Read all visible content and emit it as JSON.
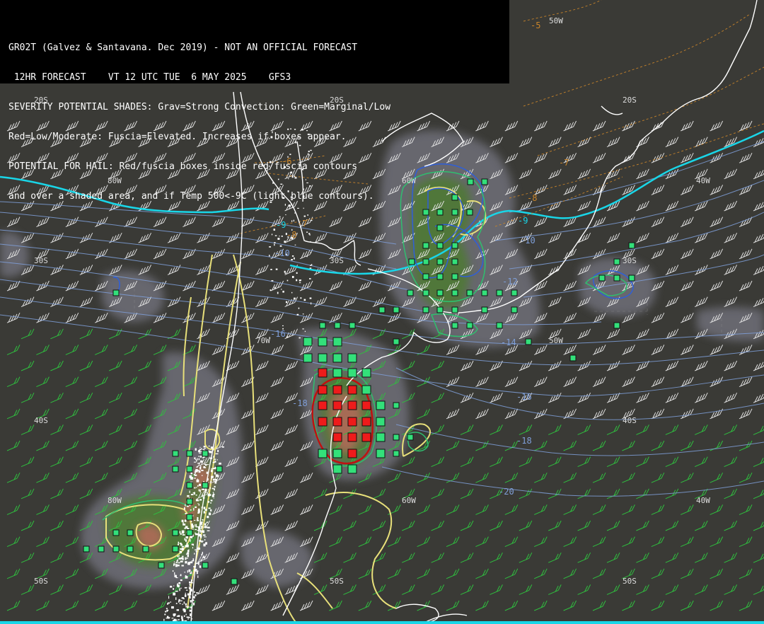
{
  "header": {
    "line1": "GR02T (Galvez & Santavana. Dec 2019) - NOT AN OFFICIAL FORECAST",
    "line2": " 12HR FORECAST    VT 12 UTC TUE  6 MAY 2025    GFS3",
    "line3": "SEVERITY POTENTIAL SHADES: Grav=Strong Convection: Green=Marginal/Low",
    "line4": "Red=Low/Moderate: Fuscia=Elevated. Increases if boxes appear.",
    "line5": "POTENTIAL FOR HAIL: Red/fuscia boxes inside red/fuscia contours",
    "line6": "and over a shaded area, and if Temp 500<-9C (light blue contours)."
  },
  "grid_labels": {
    "lat20_w": "20S",
    "lat20_c": "20S",
    "lat20_e": "20S",
    "lat30_w": "30S",
    "lat30_c": "30S",
    "lat30_e": "30S",
    "lat40_w": "40S",
    "lat40_e": "40S",
    "lat50_w": "50S",
    "lat50_c": "50S",
    "lat50_e": "50S",
    "lon80_n": "80W",
    "lon80_s": "80W",
    "lon70_n": "70W",
    "lon60_n": "60W",
    "lon60_s": "60W",
    "lon50_n": "50W",
    "lon50_s": "50W",
    "lon40_n": "40W",
    "lon40_s": "40W"
  },
  "temp_labels": {
    "t_m5": "-5",
    "t_m6": "-6",
    "t_m7a": "-7",
    "t_m7b": "-7",
    "t_m8a": "-8",
    "t_m8b": "-8",
    "t_m9a": "-9",
    "t_m9b": "-9",
    "t_m10": "-10",
    "t_m10b": "-10",
    "t_m12": "-12",
    "t_m14": "-14",
    "t_m16": "-16",
    "t_m18": "-18",
    "t_m20": "-20",
    "t_m18b": "-18",
    "t_m16b": "-16"
  },
  "colors": {
    "background": "#3a3a36",
    "coastline": "#ffffff",
    "temp_500_line": "#7f9fd9",
    "temp_minus9_line": "#19d6e8",
    "dashed_orange": "#c8842a",
    "yellow_contour": "#e8e07a",
    "green_box": "#33e07a",
    "red_box": "#ee1b1b",
    "hail_contour": "#c01010",
    "gray_shade": "#6c6c74",
    "green_shade": "#4d7a33",
    "red_shade": "#b06a58",
    "wind_barb_white": "#e0e0e0",
    "wind_barb_green": "#2fbf3f"
  },
  "map_features": {
    "coastline": "coastline",
    "wind_barbs": "wind-barbs",
    "shading": "severity-shading",
    "boxes": "severity-boxes"
  }
}
